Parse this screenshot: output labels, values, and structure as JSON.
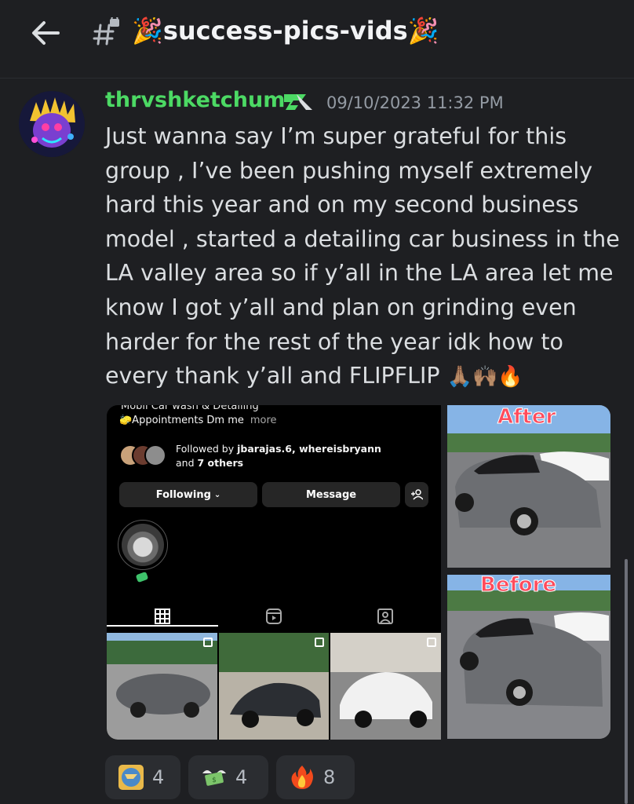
{
  "header": {
    "back_icon": "arrow-left-icon",
    "channel_icon": "locked-text-channel-icon",
    "channel_name": "🎉success-pics-vids🎉"
  },
  "message": {
    "author": "thrvshketchum",
    "author_color": "#4cd964",
    "badge_icon": "server-tag-badge-icon",
    "timestamp": "09/10/2023 11:32 PM",
    "text": "Just wanna say I’m super grateful for this group , I’ve been pushing myself extremely hard this year and on my second business model , started a detailing car business in the LA valley area so if y’all in the LA area let me know I got y’all and plan on grinding even harder for the rest of the year idk how to every thank y’all and FLIPFLIP",
    "trailing_emojis": "🙏🏽🙌🏽🔥"
  },
  "attachments": {
    "instagram": {
      "bio_cut": "Mobil Car wash & Detailing",
      "bio_line": "🧽Appointments Dm me",
      "more": "more",
      "followed_by_prefix": "Followed by ",
      "followed_by_names": "jbarajas.6, whereisbryann",
      "and_prefix": "and ",
      "others": "7 others",
      "following_label": "Following",
      "message_label": "Message"
    },
    "after_label": "After",
    "before_label": "Before"
  },
  "reactions": [
    {
      "icon": "flip-logo-emoji-icon",
      "count": "4"
    },
    {
      "icon": "money-with-wings-emoji-icon",
      "count": "4"
    },
    {
      "icon": "fire-emoji-icon",
      "count": "8"
    }
  ]
}
